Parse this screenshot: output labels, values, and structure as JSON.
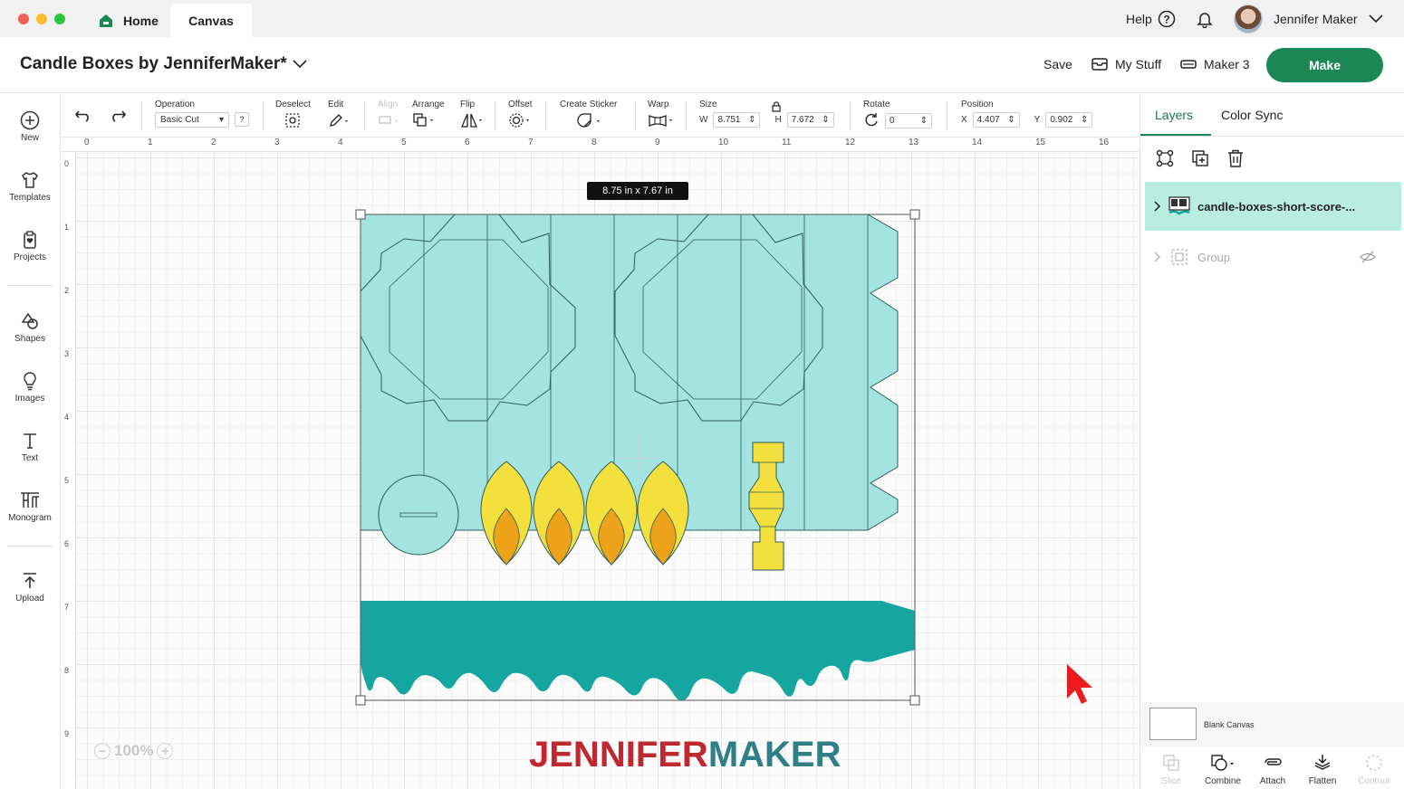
{
  "titlebar": {
    "tabs": {
      "home": "Home",
      "canvas": "Canvas"
    },
    "help": "Help",
    "user_name": "Jennifer Maker"
  },
  "header": {
    "project_title": "Candle Boxes by JenniferMaker*",
    "save": "Save",
    "my_stuff": "My Stuff",
    "machine": "Maker 3",
    "make": "Make"
  },
  "sidebar": {
    "items": [
      {
        "label": "New",
        "icon": "plus-circle-icon"
      },
      {
        "label": "Templates",
        "icon": "shirt-icon"
      },
      {
        "label": "Projects",
        "icon": "clipboard-heart-icon"
      },
      {
        "label": "Shapes",
        "icon": "shapes-icon"
      },
      {
        "label": "Images",
        "icon": "lightbulb-icon"
      },
      {
        "label": "Text",
        "icon": "text-icon"
      },
      {
        "label": "Monogram",
        "icon": "monogram-icon"
      },
      {
        "label": "Upload",
        "icon": "upload-icon"
      }
    ]
  },
  "toolbar": {
    "operation_label": "Operation",
    "operation_value": "Basic Cut",
    "help_mark": "?",
    "deselect": "Deselect",
    "edit": "Edit",
    "align": "Align",
    "arrange": "Arrange",
    "flip": "Flip",
    "offset": "Offset",
    "create_sticker": "Create Sticker",
    "warp": "Warp",
    "size_label": "Size",
    "w_axis": "W",
    "width": "8.751",
    "h_axis": "H",
    "height": "7.672",
    "rotate_label": "Rotate",
    "rotate": "0",
    "position_label": "Position",
    "x_axis": "X",
    "x": "4.407",
    "y_axis": "Y",
    "y": "0.902"
  },
  "canvas": {
    "ruler_top": [
      "0",
      "1",
      "2",
      "3",
      "4",
      "5",
      "6",
      "7",
      "8",
      "9",
      "10",
      "11",
      "12",
      "13",
      "14",
      "15",
      "16"
    ],
    "ruler_left": [
      "0",
      "1",
      "2",
      "3",
      "4",
      "5",
      "6",
      "7",
      "8",
      "9"
    ],
    "size_tooltip": "8.75  in x 7.67  in",
    "zoom": "100%",
    "logo_part1": "JENNIFER",
    "logo_part2": "MAKER",
    "colors": {
      "box": "#a3e3e0",
      "drip": "#16a6a0",
      "flame_outer": "#f4e03c",
      "flame_inner": "#eea21a",
      "holder": "#f4e03c"
    }
  },
  "panel": {
    "tab_layers": "Layers",
    "tab_color_sync": "Color Sync",
    "layer_name": "candle-boxes-short-score-...",
    "group_name": "Group",
    "blank_canvas": "Blank Canvas",
    "tools": {
      "slice": "Slice",
      "combine": "Combine",
      "attach": "Attach",
      "flatten": "Flatten",
      "contour": "Contour"
    }
  }
}
